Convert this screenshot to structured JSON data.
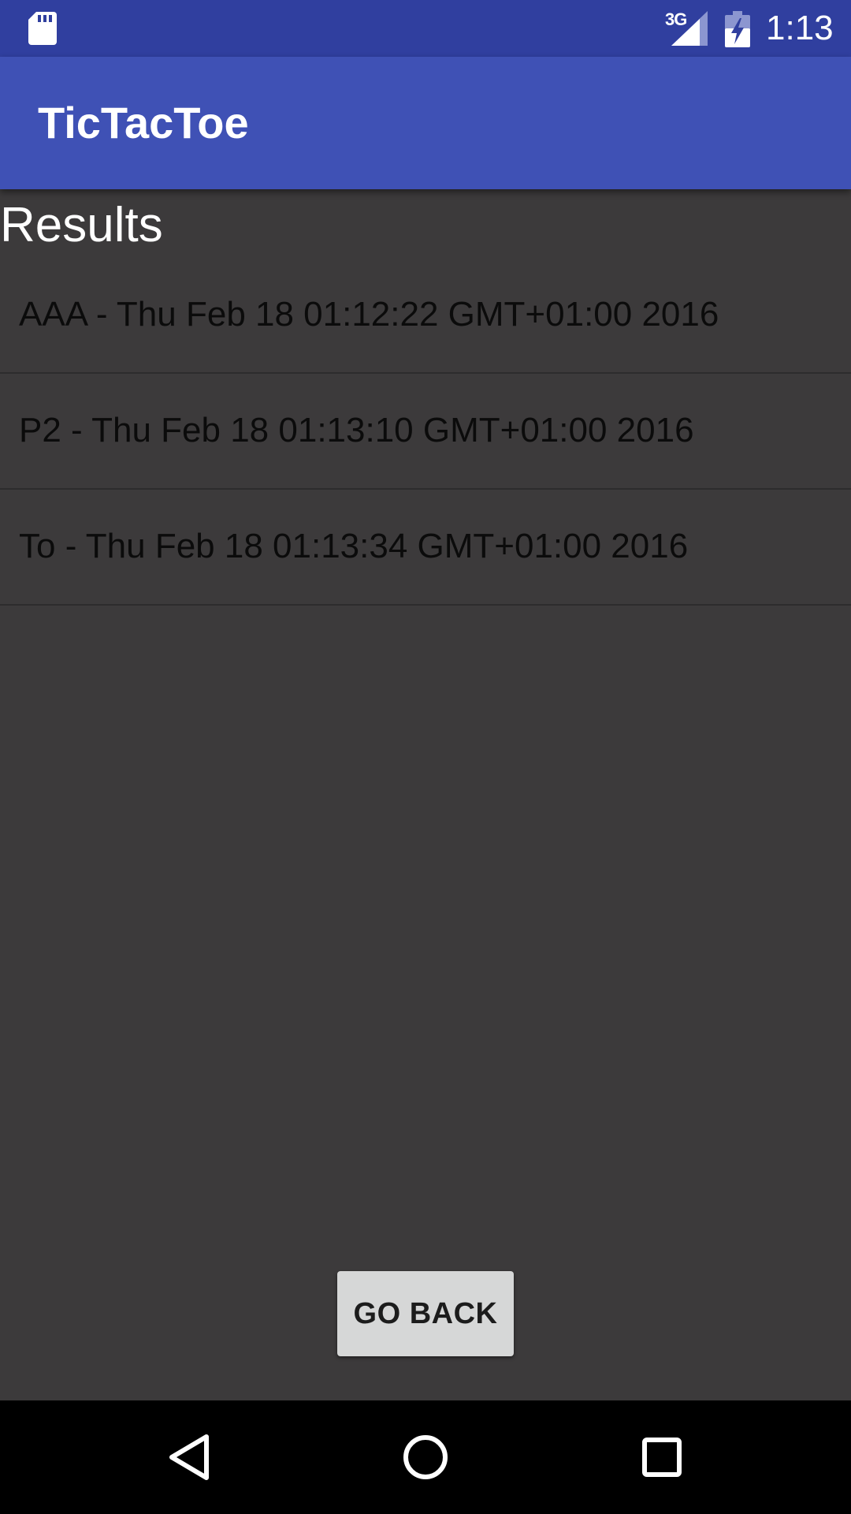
{
  "status_bar": {
    "network_type": "3G",
    "time": "1:13",
    "icons": [
      "sd-card-icon",
      "signal-icon",
      "battery-charging-icon"
    ]
  },
  "app_bar": {
    "title": "TicTacToe"
  },
  "main": {
    "heading": "Results",
    "results": [
      "AAA - Thu Feb 18 01:12:22 GMT+01:00 2016",
      "P2 - Thu Feb 18 01:13:10 GMT+01:00 2016",
      "To - Thu Feb 18 01:13:34 GMT+01:00 2016"
    ],
    "go_back_label": "GO BACK"
  },
  "nav_bar": {
    "icons": [
      "back-icon",
      "home-icon",
      "recents-icon"
    ]
  },
  "colors": {
    "status_bar": "#303f9f",
    "app_bar": "#3f51b5",
    "background": "#3c3a3b",
    "button": "#d6d7d7",
    "nav_bar": "#000000"
  }
}
